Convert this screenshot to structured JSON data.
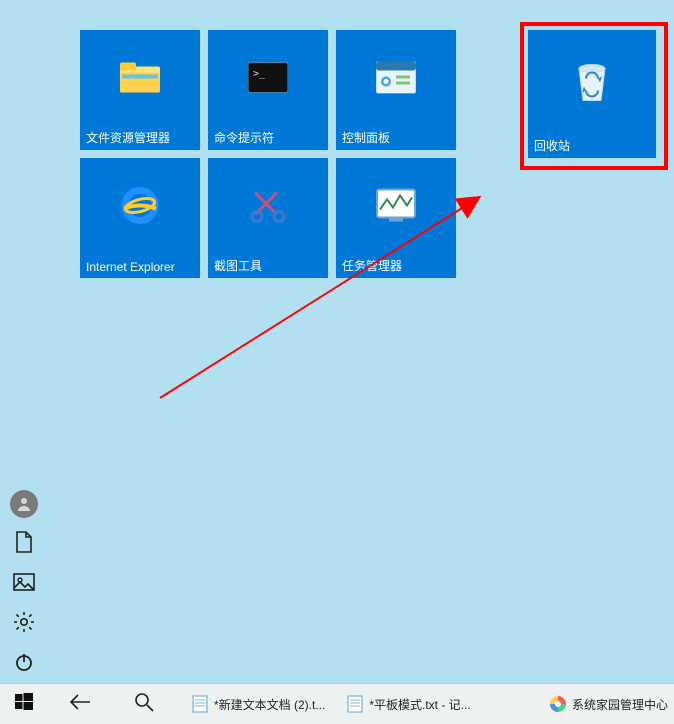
{
  "tiles": [
    {
      "name": "file-explorer",
      "label": "文件资源管理器"
    },
    {
      "name": "command-prompt",
      "label": "命令提示符"
    },
    {
      "name": "control-panel",
      "label": "控制面板"
    },
    {
      "name": "internet-explorer",
      "label": "Internet Explorer"
    },
    {
      "name": "snipping-tool",
      "label": "截图工具"
    },
    {
      "name": "task-manager",
      "label": "任务管理器"
    }
  ],
  "highlighted_tile": {
    "name": "recycle-bin",
    "label": "回收站"
  },
  "left_rail": {
    "items": [
      "user",
      "documents",
      "pictures",
      "settings",
      "power"
    ]
  },
  "taskbar": {
    "start": "start",
    "back": "back",
    "search": "search",
    "items": [
      {
        "icon": "notepad-icon",
        "label": "*新建文本文档 (2).t..."
      },
      {
        "icon": "notepad-icon",
        "label": "*平板模式.txt - 记..."
      }
    ],
    "tray": {
      "icon": "color-circle-icon",
      "label": "系统家园管理中心"
    }
  },
  "annotation": {
    "arrow_color": "#ff0000",
    "highlight_color": "#ff0000"
  }
}
